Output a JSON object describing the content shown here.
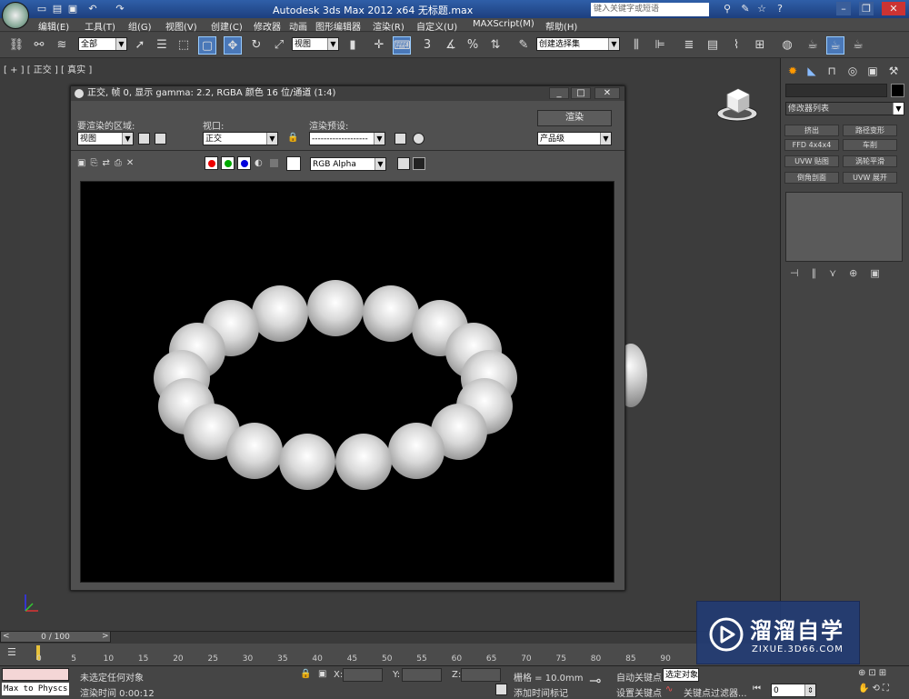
{
  "titlebar": {
    "title": "Autodesk 3ds Max  2012 x64       无标题.max",
    "search_placeholder": "键入关键字或短语"
  },
  "menus": [
    "编辑(E)",
    "工具(T)",
    "组(G)",
    "视图(V)",
    "创建(C)",
    "修改器",
    "动画",
    "图形编辑器",
    "渲染(R)",
    "自定义(U)",
    "MAXScript(M)",
    "帮助(H)"
  ],
  "main_toolbar": {
    "selection_filter": "全部",
    "coord_system": "视图",
    "snap_label": "3",
    "percent_label": "%",
    "named_selection": "创建选择集"
  },
  "viewport": {
    "label": "[ + ] [ 正交 ] [ 真实 ]"
  },
  "command_panel": {
    "modifier_list": "修改器列表",
    "modifiers": [
      "挤出",
      "路径变形",
      "FFD 4x4x4",
      "车削",
      "UVW 贴图",
      "涡轮平滑",
      "倒角剖面",
      "UVW 展开"
    ]
  },
  "render_window": {
    "title": "正交, 帧 0, 显示 gamma: 2.2, RGBA 颜色 16 位/通道 (1:4)",
    "area_label": "要渲染的区域:",
    "area_value": "视图",
    "viewport_label": "视口:",
    "viewport_value": "正交",
    "preset_label": "渲染预设:",
    "preset_value": "-------------------",
    "render_button": "渲染",
    "quality_value": "产品级",
    "channel_value": "RGB Alpha"
  },
  "timeline": {
    "frame_display": "0 / 100",
    "ticks": [
      "0",
      "5",
      "10",
      "15",
      "20",
      "25",
      "30",
      "35",
      "40",
      "45",
      "50",
      "55",
      "60",
      "65",
      "70",
      "75",
      "80",
      "85",
      "90"
    ]
  },
  "status": {
    "maxscript": "Max to Physcs (",
    "selection": "未选定任何对象",
    "render_time": "渲染时间  0:00:12",
    "x_label": "X:",
    "y_label": "Y:",
    "z_label": "Z:",
    "grid": "栅格 = 10.0mm",
    "add_time_tag": "添加时间标记",
    "auto_key": "自动关键点",
    "set_key": "设置关键点",
    "selected_object": "选定对象",
    "key_filter": "关键点过滤器...",
    "current_frame": "0"
  },
  "watermark": {
    "brand": "溜溜自学",
    "url": "ZIXUE.3D66.COM"
  },
  "chart_data": {
    "type": "table",
    "ring_pearl_count": 17
  }
}
